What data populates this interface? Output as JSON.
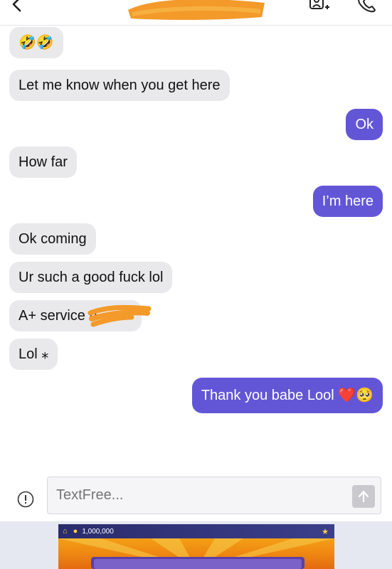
{
  "header": {
    "back_icon": "chevron-left-icon",
    "contact_icon": "add-contact-icon",
    "call_icon": "phone-icon"
  },
  "messages": [
    {
      "dir": "in",
      "text": "🤣🤣"
    },
    {
      "dir": "in",
      "text": "Let me know when you get here"
    },
    {
      "dir": "out",
      "text": "Ok"
    },
    {
      "dir": "in",
      "text": "How far"
    },
    {
      "dir": "out",
      "text": "I’m here"
    },
    {
      "dir": "in",
      "text": "Ok coming"
    },
    {
      "dir": "in",
      "text": "Ur such a good fuck lol"
    },
    {
      "dir": "in",
      "text": "A+ service n"
    },
    {
      "dir": "in",
      "text": "Lol ⁎"
    },
    {
      "dir": "out",
      "text": "Thank you babe Lool ❤️🥺"
    }
  ],
  "compose": {
    "placeholder": "TextFree...",
    "info_icon": "info-icon",
    "send_icon": "send-arrow-icon"
  },
  "ad": {
    "coins": "1,000,000"
  },
  "colors": {
    "outgoing": "#6356d6",
    "incoming": "#e9e9ec",
    "redaction": "#f39a2a"
  }
}
